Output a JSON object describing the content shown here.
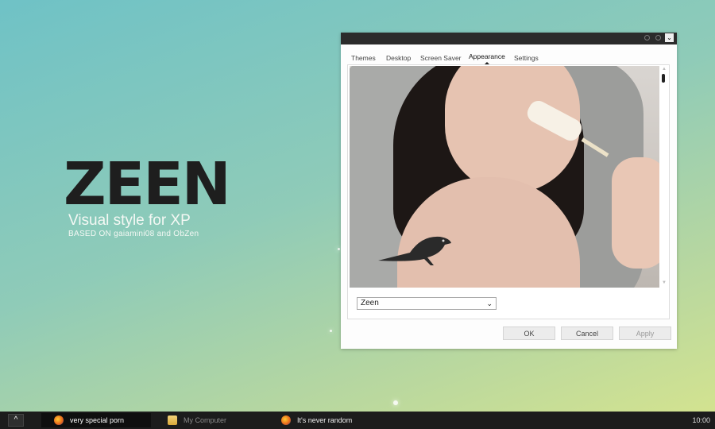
{
  "brand": {
    "title": "ZEEN",
    "subtitle": "Visual style for XP",
    "based_on": "BASED ON gaiamini08 and ObZen"
  },
  "window": {
    "tabs": [
      "Themes",
      "Desktop",
      "Screen Saver",
      "Appearance",
      "Settings"
    ],
    "active_tab": "Appearance",
    "theme_select": {
      "value": "Zeen"
    },
    "buttons": {
      "ok": "OK",
      "cancel": "Cancel",
      "apply": "Apply"
    }
  },
  "taskbar": {
    "start_glyph": "^",
    "tasks": [
      {
        "label": "very special porn",
        "icon": "firefox-icon",
        "active": true
      },
      {
        "label": "My Computer",
        "icon": "folder-icon",
        "active": false
      },
      {
        "label": "It's never random",
        "icon": "firefox-icon",
        "active": false
      }
    ],
    "clock": "10:00"
  },
  "colors": {
    "accent_dark": "#1e1e1e",
    "taskbar": "#1c1c1c",
    "titlebar": "#2b2b2b"
  }
}
